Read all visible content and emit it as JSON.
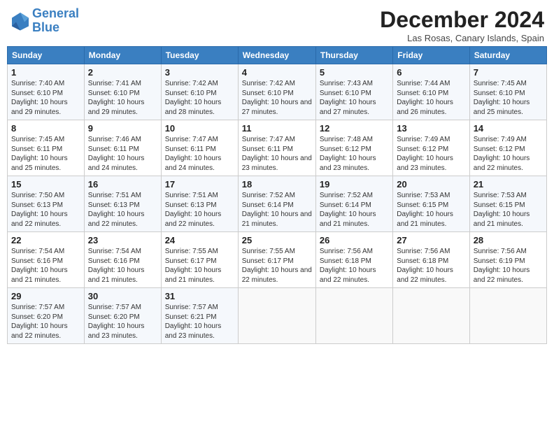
{
  "header": {
    "logo_line1": "General",
    "logo_line2": "Blue",
    "title": "December 2024",
    "location": "Las Rosas, Canary Islands, Spain"
  },
  "days_of_week": [
    "Sunday",
    "Monday",
    "Tuesday",
    "Wednesday",
    "Thursday",
    "Friday",
    "Saturday"
  ],
  "weeks": [
    [
      {
        "day": "1",
        "sunrise": "Sunrise: 7:40 AM",
        "sunset": "Sunset: 6:10 PM",
        "daylight": "Daylight: 10 hours and 29 minutes."
      },
      {
        "day": "2",
        "sunrise": "Sunrise: 7:41 AM",
        "sunset": "Sunset: 6:10 PM",
        "daylight": "Daylight: 10 hours and 29 minutes."
      },
      {
        "day": "3",
        "sunrise": "Sunrise: 7:42 AM",
        "sunset": "Sunset: 6:10 PM",
        "daylight": "Daylight: 10 hours and 28 minutes."
      },
      {
        "day": "4",
        "sunrise": "Sunrise: 7:42 AM",
        "sunset": "Sunset: 6:10 PM",
        "daylight": "Daylight: 10 hours and 27 minutes."
      },
      {
        "day": "5",
        "sunrise": "Sunrise: 7:43 AM",
        "sunset": "Sunset: 6:10 PM",
        "daylight": "Daylight: 10 hours and 27 minutes."
      },
      {
        "day": "6",
        "sunrise": "Sunrise: 7:44 AM",
        "sunset": "Sunset: 6:10 PM",
        "daylight": "Daylight: 10 hours and 26 minutes."
      },
      {
        "day": "7",
        "sunrise": "Sunrise: 7:45 AM",
        "sunset": "Sunset: 6:10 PM",
        "daylight": "Daylight: 10 hours and 25 minutes."
      }
    ],
    [
      {
        "day": "8",
        "sunrise": "Sunrise: 7:45 AM",
        "sunset": "Sunset: 6:11 PM",
        "daylight": "Daylight: 10 hours and 25 minutes."
      },
      {
        "day": "9",
        "sunrise": "Sunrise: 7:46 AM",
        "sunset": "Sunset: 6:11 PM",
        "daylight": "Daylight: 10 hours and 24 minutes."
      },
      {
        "day": "10",
        "sunrise": "Sunrise: 7:47 AM",
        "sunset": "Sunset: 6:11 PM",
        "daylight": "Daylight: 10 hours and 24 minutes."
      },
      {
        "day": "11",
        "sunrise": "Sunrise: 7:47 AM",
        "sunset": "Sunset: 6:11 PM",
        "daylight": "Daylight: 10 hours and 23 minutes."
      },
      {
        "day": "12",
        "sunrise": "Sunrise: 7:48 AM",
        "sunset": "Sunset: 6:12 PM",
        "daylight": "Daylight: 10 hours and 23 minutes."
      },
      {
        "day": "13",
        "sunrise": "Sunrise: 7:49 AM",
        "sunset": "Sunset: 6:12 PM",
        "daylight": "Daylight: 10 hours and 23 minutes."
      },
      {
        "day": "14",
        "sunrise": "Sunrise: 7:49 AM",
        "sunset": "Sunset: 6:12 PM",
        "daylight": "Daylight: 10 hours and 22 minutes."
      }
    ],
    [
      {
        "day": "15",
        "sunrise": "Sunrise: 7:50 AM",
        "sunset": "Sunset: 6:13 PM",
        "daylight": "Daylight: 10 hours and 22 minutes."
      },
      {
        "day": "16",
        "sunrise": "Sunrise: 7:51 AM",
        "sunset": "Sunset: 6:13 PM",
        "daylight": "Daylight: 10 hours and 22 minutes."
      },
      {
        "day": "17",
        "sunrise": "Sunrise: 7:51 AM",
        "sunset": "Sunset: 6:13 PM",
        "daylight": "Daylight: 10 hours and 22 minutes."
      },
      {
        "day": "18",
        "sunrise": "Sunrise: 7:52 AM",
        "sunset": "Sunset: 6:14 PM",
        "daylight": "Daylight: 10 hours and 21 minutes."
      },
      {
        "day": "19",
        "sunrise": "Sunrise: 7:52 AM",
        "sunset": "Sunset: 6:14 PM",
        "daylight": "Daylight: 10 hours and 21 minutes."
      },
      {
        "day": "20",
        "sunrise": "Sunrise: 7:53 AM",
        "sunset": "Sunset: 6:15 PM",
        "daylight": "Daylight: 10 hours and 21 minutes."
      },
      {
        "day": "21",
        "sunrise": "Sunrise: 7:53 AM",
        "sunset": "Sunset: 6:15 PM",
        "daylight": "Daylight: 10 hours and 21 minutes."
      }
    ],
    [
      {
        "day": "22",
        "sunrise": "Sunrise: 7:54 AM",
        "sunset": "Sunset: 6:16 PM",
        "daylight": "Daylight: 10 hours and 21 minutes."
      },
      {
        "day": "23",
        "sunrise": "Sunrise: 7:54 AM",
        "sunset": "Sunset: 6:16 PM",
        "daylight": "Daylight: 10 hours and 21 minutes."
      },
      {
        "day": "24",
        "sunrise": "Sunrise: 7:55 AM",
        "sunset": "Sunset: 6:17 PM",
        "daylight": "Daylight: 10 hours and 21 minutes."
      },
      {
        "day": "25",
        "sunrise": "Sunrise: 7:55 AM",
        "sunset": "Sunset: 6:17 PM",
        "daylight": "Daylight: 10 hours and 22 minutes."
      },
      {
        "day": "26",
        "sunrise": "Sunrise: 7:56 AM",
        "sunset": "Sunset: 6:18 PM",
        "daylight": "Daylight: 10 hours and 22 minutes."
      },
      {
        "day": "27",
        "sunrise": "Sunrise: 7:56 AM",
        "sunset": "Sunset: 6:18 PM",
        "daylight": "Daylight: 10 hours and 22 minutes."
      },
      {
        "day": "28",
        "sunrise": "Sunrise: 7:56 AM",
        "sunset": "Sunset: 6:19 PM",
        "daylight": "Daylight: 10 hours and 22 minutes."
      }
    ],
    [
      {
        "day": "29",
        "sunrise": "Sunrise: 7:57 AM",
        "sunset": "Sunset: 6:20 PM",
        "daylight": "Daylight: 10 hours and 22 minutes."
      },
      {
        "day": "30",
        "sunrise": "Sunrise: 7:57 AM",
        "sunset": "Sunset: 6:20 PM",
        "daylight": "Daylight: 10 hours and 23 minutes."
      },
      {
        "day": "31",
        "sunrise": "Sunrise: 7:57 AM",
        "sunset": "Sunset: 6:21 PM",
        "daylight": "Daylight: 10 hours and 23 minutes."
      },
      null,
      null,
      null,
      null
    ]
  ]
}
